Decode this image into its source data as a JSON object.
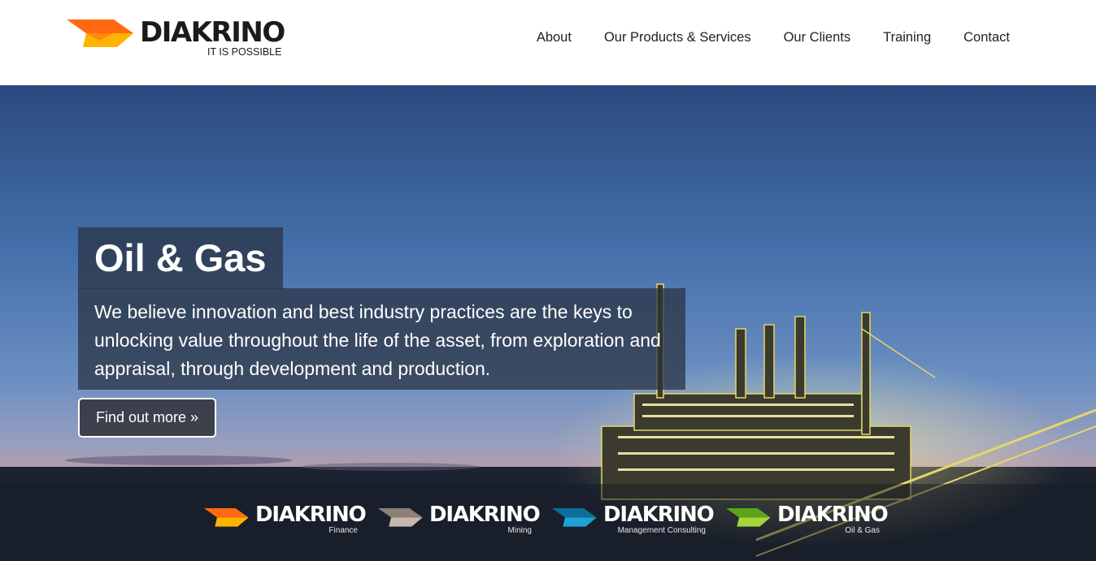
{
  "header": {
    "logo": {
      "wordmark": "DIAKRINO",
      "tagline": "IT IS POSSIBLE"
    },
    "nav": [
      {
        "label": "About"
      },
      {
        "label": "Our Products & Services"
      },
      {
        "label": "Our Clients"
      },
      {
        "label": "Training"
      },
      {
        "label": "Contact"
      }
    ]
  },
  "hero": {
    "title": "Oil & Gas",
    "text": "We believe innovation and best industry practices are the keys to unlocking value throughout the life of the asset, from exploration and appraisal, through development and production.",
    "button_label": "Find out more »"
  },
  "brands": [
    {
      "wordmark": "DIAKRINO",
      "division": "Finance",
      "colors": [
        "#ff6a13",
        "#ffb400"
      ]
    },
    {
      "wordmark": "DIAKRINO",
      "division": "Mining",
      "colors": [
        "#8c7f78",
        "#c7b8ad"
      ]
    },
    {
      "wordmark": "DIAKRINO",
      "division": "Management Consulting",
      "colors": [
        "#0e6e99",
        "#1aa3d4"
      ]
    },
    {
      "wordmark": "DIAKRINO",
      "division": "Oil & Gas",
      "colors": [
        "#5ea41a",
        "#a4d63a"
      ]
    }
  ],
  "colors": {
    "logo_orange": "#ff6a13",
    "logo_yellow": "#ffb400",
    "text_dark": "#1b1b1b",
    "overlay": "rgba(40,48,62,0.72)"
  },
  "icons": {
    "logo_mark": "chevron-arrow-icon",
    "brand_mark": "chevron-arrow-icon"
  }
}
